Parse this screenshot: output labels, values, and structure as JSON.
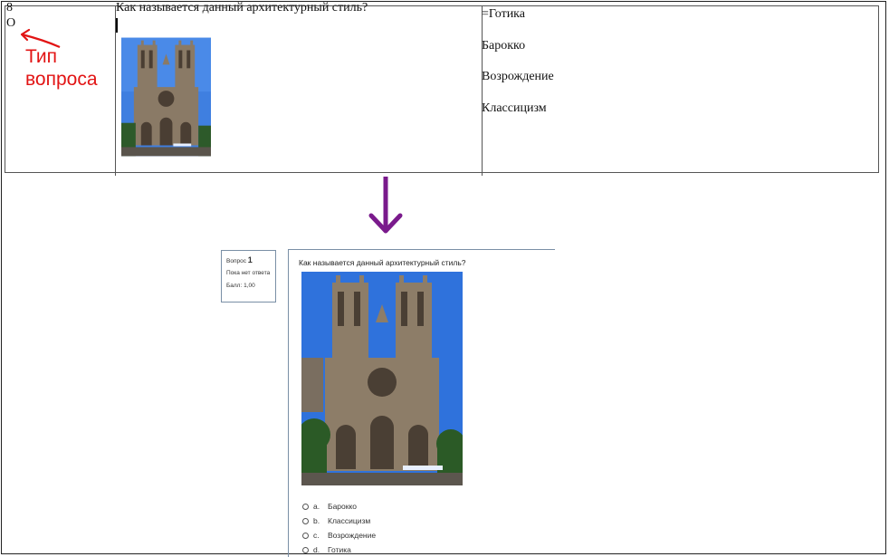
{
  "source_table": {
    "number": "8",
    "type_code": "O",
    "question": "Как называется данный архитектурный стиль?",
    "answers": [
      "=Готика",
      "Барокко",
      "Возрождение",
      "Классицизм"
    ]
  },
  "annotation": {
    "line1": "Тип",
    "line2": "вопроса",
    "color": "#e21414"
  },
  "arrow_color": "#7a1a8c",
  "quiz_preview": {
    "question_label": "Вопрос",
    "question_number": "1",
    "state": "Пока нет ответа",
    "mark": "Балл: 1,00",
    "prompt": "Как называется данный архитектурный стиль?",
    "options": [
      {
        "letter": "a.",
        "text": "Барокко"
      },
      {
        "letter": "b.",
        "text": "Классицизм"
      },
      {
        "letter": "c.",
        "text": "Возрождение"
      },
      {
        "letter": "d.",
        "text": "Готика"
      }
    ]
  }
}
